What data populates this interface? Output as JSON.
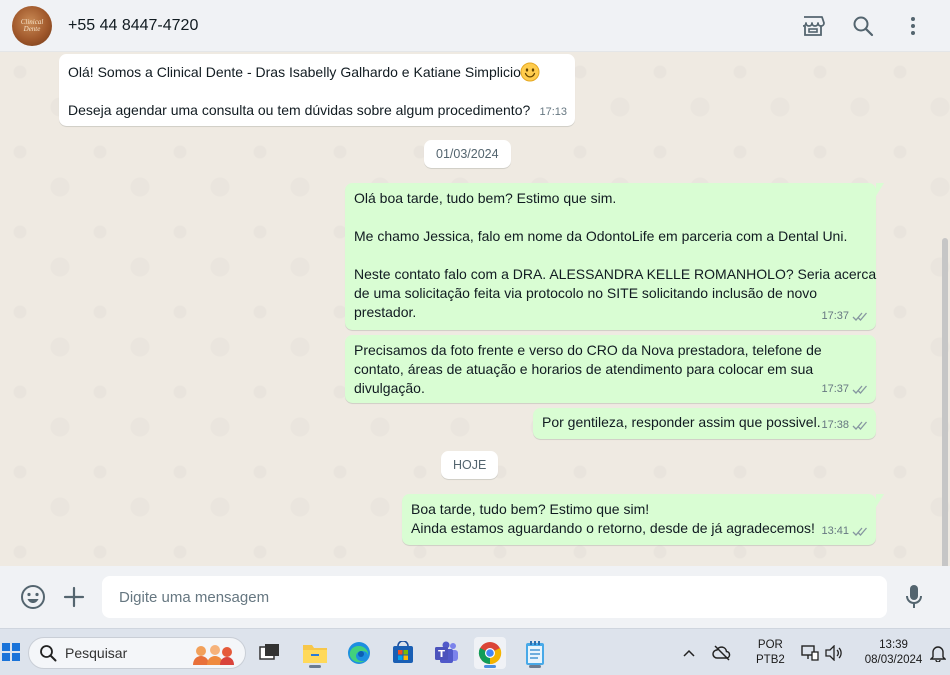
{
  "header": {
    "avatar_logo_text": "Clinical Dente",
    "contact_name": "+55 44 8447-4720",
    "icons": [
      "store-icon",
      "search-icon",
      "more-vertical-icon"
    ]
  },
  "messages": [
    {
      "direction": "incoming",
      "lines": [
        "Olá! Somos a Clinical Dente - Dras Isabelly Galhardo e Katiane Simplicio",
        "",
        "Deseja agendar uma consulta ou tem dúvidas sobre algum procedimento?"
      ],
      "emoji": "smiling-face-icon",
      "time": "17:13"
    },
    {
      "direction": "outgoing",
      "lines": [
        "Olá boa tarde, tudo bem? Estimo que sim.",
        "",
        "Me chamo Jessica, falo em nome da OdontoLife em parceria com a Dental Uni.",
        "",
        "Neste contato falo com a DRA. ALESSANDRA KELLE ROMANHOLO? Seria acerca",
        "de uma solicitação feita via protocolo no SITE solicitando inclusão de novo",
        "prestador."
      ],
      "time": "17:37",
      "status": "read"
    },
    {
      "direction": "outgoing",
      "lines": [
        "Precisamos da foto frente e verso do CRO da Nova prestadora, telefone de",
        "contato, áreas de atuação e horarios de atendimento para colocar em sua",
        "divulgação."
      ],
      "time": "17:37",
      "status": "read"
    },
    {
      "direction": "outgoing",
      "lines": [
        "Por gentileza, responder assim que possivel."
      ],
      "time": "17:38",
      "status": "read"
    },
    {
      "direction": "outgoing",
      "lines": [
        "Boa tarde, tudo bem? Estimo que sim!",
        "Ainda estamos aguardando o retorno, desde de já agradecemos!"
      ],
      "time": "13:41",
      "status": "read"
    }
  ],
  "date_dividers": [
    "01/03/2024",
    "HOJE"
  ],
  "composer": {
    "placeholder": "Digite uma mensagem",
    "icons": [
      "emoji-icon",
      "plus-icon",
      "microphone-icon"
    ]
  },
  "taskbar": {
    "search_label": "Pesquisar",
    "apps": [
      "task-view-icon",
      "file-explorer-icon",
      "edge-icon",
      "store-icon",
      "teams-icon",
      "chrome-icon",
      "notepad-icon"
    ],
    "language_top": "POR",
    "language_bottom": "PTB2",
    "time": "13:39",
    "date": "08/03/2024"
  },
  "colors": {
    "outgoing_bubble": "#d9fdd3",
    "incoming_bubble": "#ffffff",
    "chat_bg": "#efeae2",
    "read_tick": "#53bdeb"
  }
}
